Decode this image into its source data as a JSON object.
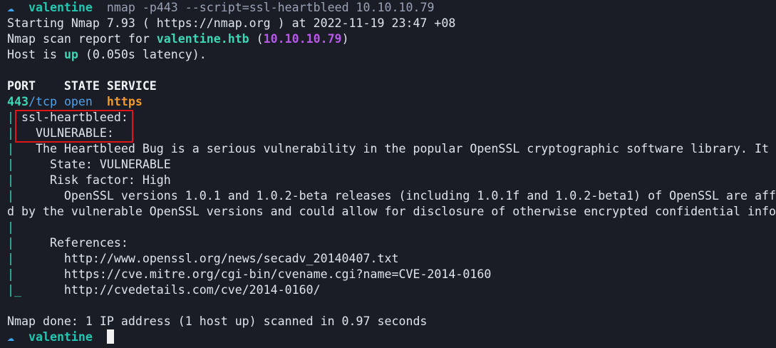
{
  "prompt": {
    "icon": "☁",
    "host": "valentine",
    "command": "nmap -p443 --script=ssl-heartbleed 10.10.10.79"
  },
  "lines": {
    "starting": "Starting Nmap 7.93 ( https://nmap.org ) at 2022-11-19 23:47 +08",
    "report_prefix": "Nmap scan report for ",
    "report_host": "valentine.htb",
    "report_open": " (",
    "report_ip": "10.10.10.79",
    "report_close": ")",
    "host_prefix": "Host is ",
    "host_state": "up",
    "host_suffix": " (0.050s latency).",
    "header": "PORT    STATE SERVICE",
    "port_num": "443",
    "port_proto": "/tcp",
    "port_state": " open  ",
    "port_service": "https",
    "script_name": " ssl-heartbleed:",
    "vuln_label": "   VULNERABLE:",
    "desc": "   The Heartbleed Bug is a serious vulnerability in the popular OpenSSL cryptographic software library. It",
    "state": "     State: VULNERABLE",
    "risk": "     Risk factor: High",
    "versions": "       OpenSSL versions 1.0.1 and 1.0.2-beta releases (including 1.0.1f and 1.0.2-beta1) of OpenSSL are aff",
    "versions_wrap": "d by the vulnerable OpenSSL versions and could allow for disclosure of otherwise encrypted confidential info",
    "refs": "     References:",
    "ref1": "       http://www.openssl.org/news/secadv_20140407.txt",
    "ref2": "       https://cve.mitre.org/cgi-bin/cvename.cgi?name=CVE-2014-0160",
    "ref3": "      http://cvedetails.com/cve/2014-0160/",
    "done": "Nmap done: 1 IP address (1 host up) scanned in 0.97 seconds"
  },
  "bar_glyph": "|",
  "bar_end_glyph": "|_",
  "colors": {
    "background": "#1b1d26",
    "highlight_border": "#e0141b"
  }
}
